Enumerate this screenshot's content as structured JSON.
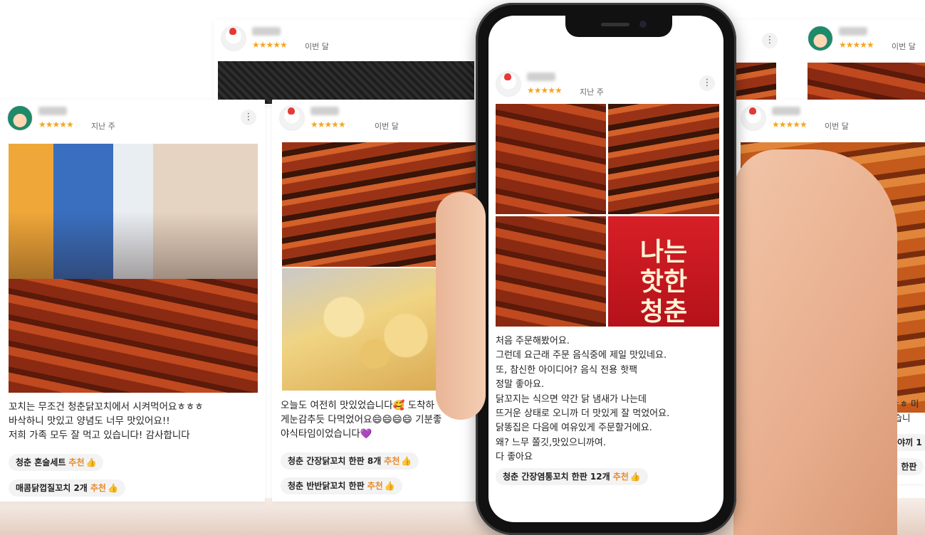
{
  "colors": {
    "star": "#f5a623",
    "recommend": "#e88a2a",
    "chip_bg": "#f3f3f3"
  },
  "stars": "★★★★★",
  "kebab_symbol": "⋮",
  "recommend_label": "추천",
  "thumb_symbol": "👍",
  "cards": {
    "top_back": {
      "when": "이번 달"
    },
    "top_right": {
      "when": "이번 달"
    },
    "left": {
      "when": "지난 주",
      "text": "꼬치는 무조건 청춘닭꼬치에서 시켜먹어요ㅎㅎㅎ\n바삭하니 맛있고 양념도 너무 맛있어요!!\n저희 가족 모두 잘 먹고 있습니다! 감사합니다",
      "tags": [
        "청춘 혼술세트",
        "매콤닭껍질꼬치 2개"
      ]
    },
    "middle": {
      "when": "이번 달",
      "text": "오늘도 여전히 맛있었습니다🥰 도착하\n게눈감추듯 다먹었어요😄😄😄😄 기분좋\n야식타임이었습니다💜",
      "tags": [
        "청춘 간장닭꼬치 한판 8개",
        "청춘 반반닭꼬치 한판"
      ]
    },
    "phone": {
      "when": "지난 주",
      "text": "처음 주문해봤어요.\n그런데 요근래 주문 음식중에 제일 맛있네요.\n또, 참신한 아이디어? 음식 전용 핫팩\n정말 좋아요.\n닭꼬지는 식으면 약간 닭 냄새가 나는데\n뜨거운 상태로 오니까 더 맛있게 잘 먹었어요.\n닭똥집은 다음에 여유있게 주문할거에요.\n왜? 느무 쫄깃,맛있으니까여.\n다 좋아요",
      "pack_text": "나는\n핫한\n청춘",
      "tags": [
        "청춘 간장염통꼬치 한판 12개"
      ]
    },
    "right": {
      "when": "이번 달",
      "text": "에 없지만.. ㅎㅎ 미\n끼도 잘 먹었습니",
      "tags": [
        "데리타코야끼 1",
        "반반닭꼬치 한판"
      ]
    }
  }
}
